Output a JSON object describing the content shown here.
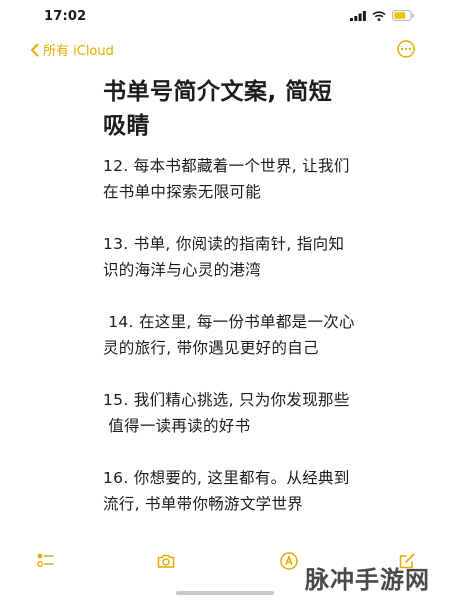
{
  "status": {
    "time": "17:02"
  },
  "nav": {
    "back_label": "所有 iCloud"
  },
  "note": {
    "title_line1": "书单号简介文案, 简短",
    "title_line2": "吸睛",
    "paragraphs": [
      [
        "12. 每本书都藏着一个世界, 让我们",
        "在书单中探索无限可能"
      ],
      [
        "13. 书单, 你阅读的指南针, 指向知",
        "识的海洋与心灵的港湾"
      ],
      [
        " 14. 在这里, 每一份书单都是一次心",
        "灵的旅行, 带你遇见更好的自己"
      ],
      [
        "15. 我们精心挑选, 只为你发现那些",
        " 值得一读再读的好书"
      ],
      [
        "16. 你想要的, 这里都有。从经典到",
        "流行, 书单带你畅游文学世界"
      ]
    ]
  },
  "toolbar": {
    "icons": [
      "checklist-icon",
      "camera-icon",
      "markup-icon",
      "compose-icon"
    ]
  },
  "watermark": {
    "text": "脉冲手游网"
  },
  "colors": {
    "accent": "#e8a900",
    "text": "#1c1c1e",
    "background": "#ffffff"
  }
}
